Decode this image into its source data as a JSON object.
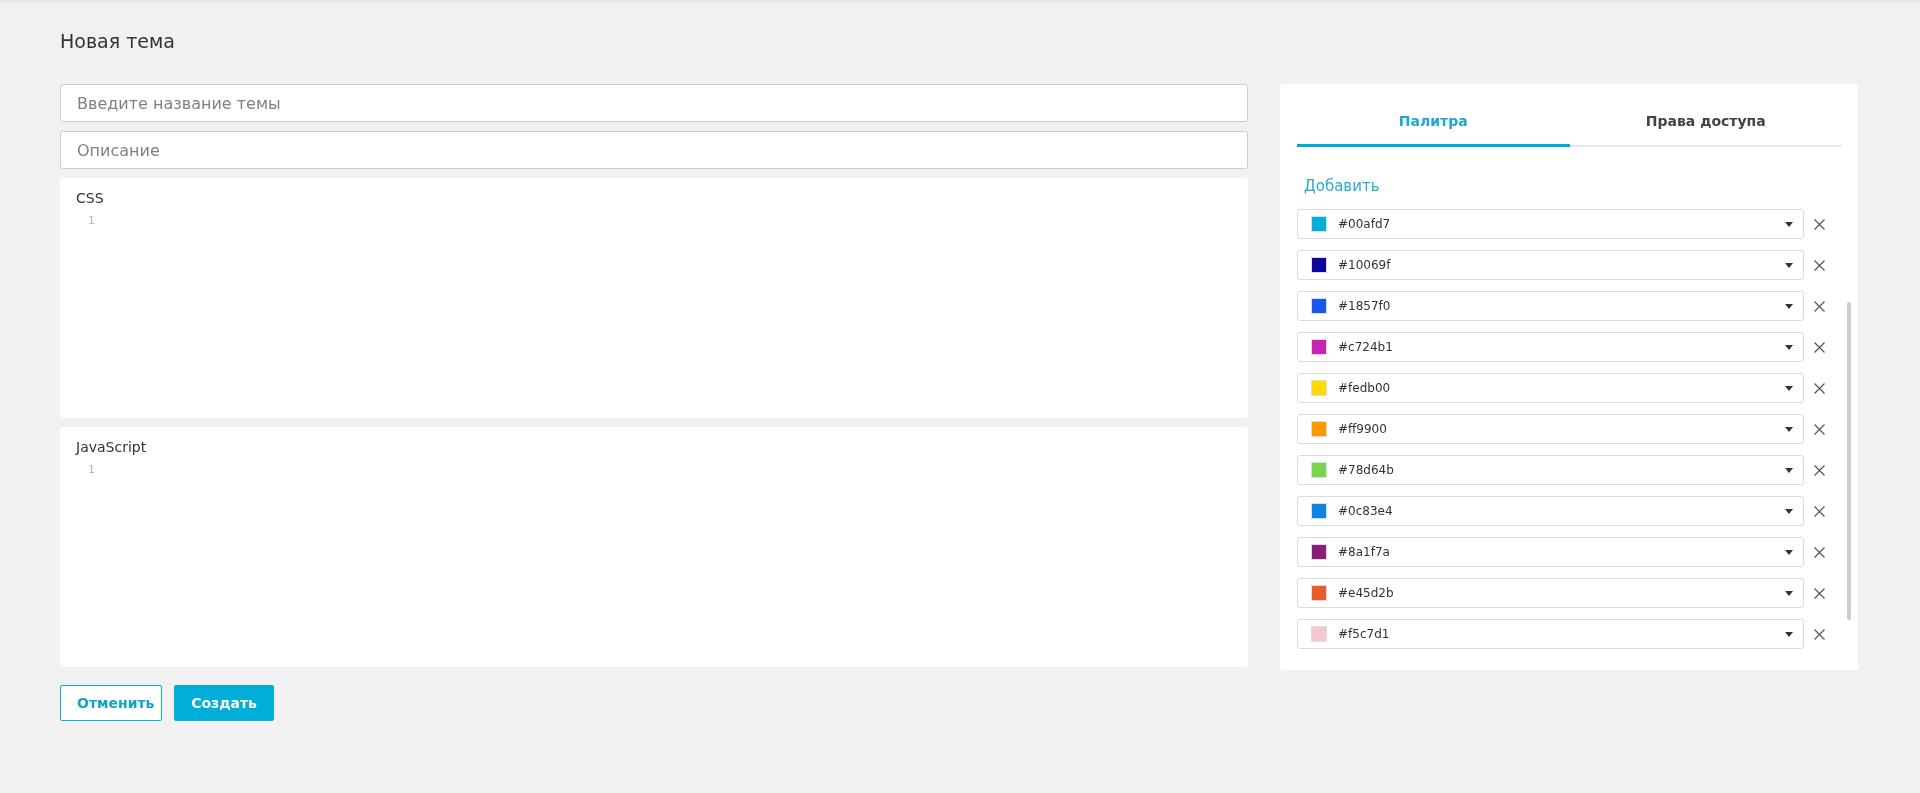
{
  "page_title": "Новая тема",
  "name_field": {
    "placeholder": "Введите название темы"
  },
  "description_field": {
    "placeholder": "Описание"
  },
  "editors": [
    {
      "label": "CSS",
      "line_numbers": [
        "1"
      ]
    },
    {
      "label": "JavaScript",
      "line_numbers": [
        "1"
      ]
    }
  ],
  "buttons": [
    {
      "label": "Отменить",
      "kind": "secondary"
    },
    {
      "label": "Создать",
      "kind": "primary"
    }
  ],
  "tabs": [
    {
      "label": "Палитра",
      "selected": true
    },
    {
      "label": "Права доступа",
      "selected": false
    }
  ],
  "add_link": "Добавить",
  "palette": [
    {
      "value": "#00afd7",
      "color": "#00afd7"
    },
    {
      "value": "#10069f",
      "color": "#10069f"
    },
    {
      "value": "#1857f0",
      "color": "#1857f0"
    },
    {
      "value": "#c724b1",
      "color": "#c724b1"
    },
    {
      "value": "#fedb00",
      "color": "#fedb00"
    },
    {
      "value": "#ff9900",
      "color": "#ff9900"
    },
    {
      "value": "#78d64b",
      "color": "#78d64b"
    },
    {
      "value": "#0c83e4",
      "color": "#0c83e4"
    },
    {
      "value": "#8a1f7a",
      "color": "#8a1f7a"
    },
    {
      "value": "#e45d2b",
      "color": "#e45d2b"
    },
    {
      "value": "#f5c7d1",
      "color": "#f5c7d1"
    }
  ]
}
